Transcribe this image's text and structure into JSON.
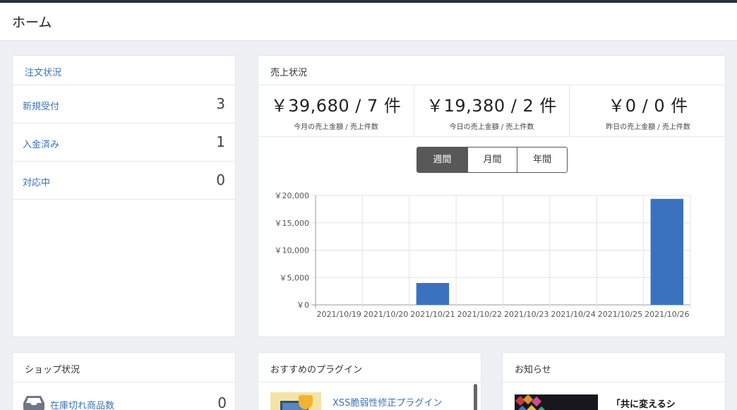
{
  "header": {
    "title": "ホーム"
  },
  "order_status": {
    "title": "注文状況",
    "rows": [
      {
        "label": "新規受付",
        "count": "3"
      },
      {
        "label": "入金済み",
        "count": "1"
      },
      {
        "label": "対応中",
        "count": "0"
      }
    ]
  },
  "sales": {
    "title": "売上状況",
    "kpis": [
      {
        "value": "￥39,680 / 7 件",
        "caption": "今月の売上金額 / 売上件数"
      },
      {
        "value": "￥19,380 / 2 件",
        "caption": "今日の売上金額 / 売上件数"
      },
      {
        "value": "￥0 / 0 件",
        "caption": "昨日の売上金額 / 売上件数"
      }
    ],
    "period_tabs": [
      "週間",
      "月間",
      "年間"
    ],
    "active_period": "週間"
  },
  "chart_data": {
    "type": "bar",
    "title": "",
    "xlabel": "",
    "ylabel": "",
    "categories": [
      "2021/10/19",
      "2021/10/20",
      "2021/10/21",
      "2021/10/22",
      "2021/10/23",
      "2021/10/24",
      "2021/10/25",
      "2021/10/26"
    ],
    "values": [
      0,
      0,
      4000,
      0,
      0,
      0,
      0,
      19380
    ],
    "ylim": [
      0,
      20000
    ],
    "yticks": [
      0,
      5000,
      10000,
      15000,
      20000
    ],
    "ytick_labels": [
      "￥0",
      "￥5,000",
      "￥10,000",
      "￥15,000",
      "￥20,000"
    ],
    "grid": true,
    "bar_color": "#3a72bf"
  },
  "shop_status": {
    "title": "ショップ状況",
    "rows": [
      {
        "label": "在庫切れ商品数",
        "count": "0",
        "icon": "inbox-tray-icon"
      }
    ]
  },
  "plugins": {
    "title": "おすすめのプラグイン",
    "items": [
      {
        "label": "XSS脆弱性修正プラグイン",
        "icon": "shield-icon"
      }
    ]
  },
  "news": {
    "title": "お知らせ",
    "items": [
      {
        "title": "「共に変えるシ"
      }
    ]
  },
  "colors": {
    "link": "#3a72b5",
    "bar": "#3a72bf",
    "active_tab": "#585858"
  }
}
